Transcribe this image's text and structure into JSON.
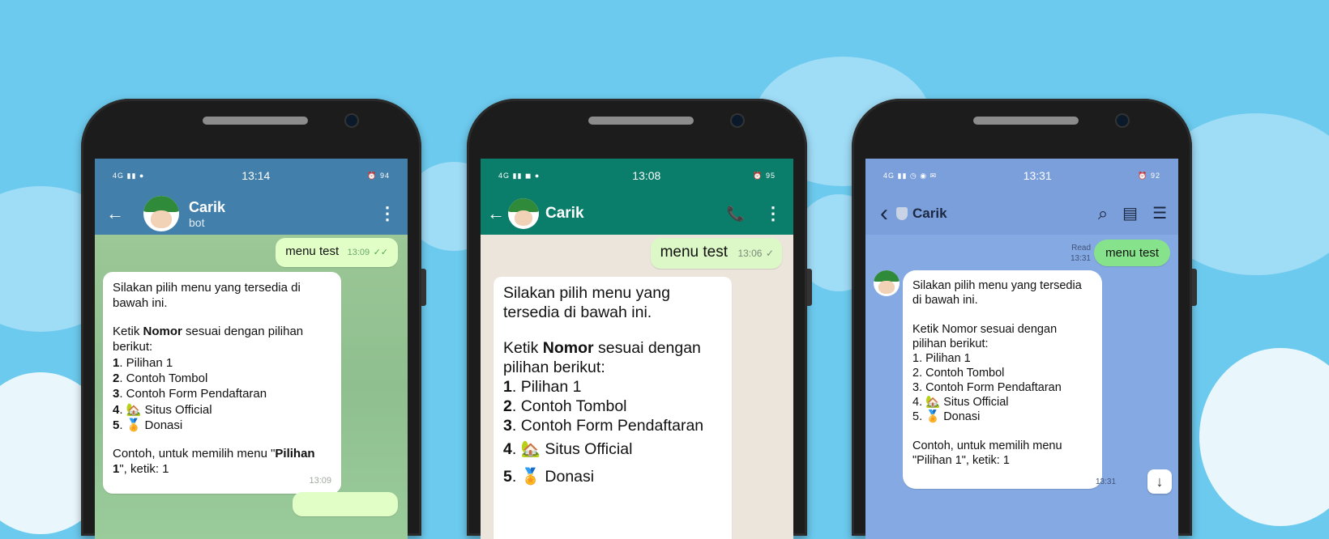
{
  "telegram": {
    "status_time": "13:14",
    "status_left": "4G ▮▮ ●",
    "status_right": "⏰ 94",
    "contact_name": "Carik",
    "contact_sub": "bot",
    "back_glyph": "←",
    "menu_glyph": "⋮",
    "sent_text": "menu test",
    "sent_time": "13:09",
    "sent_ticks": "✓✓",
    "recv_line1": "Silakan pilih menu yang tersedia di",
    "recv_line2": "bawah ini.",
    "recv_ketik_pre": "Ketik ",
    "recv_ketik_bold": "Nomor",
    "recv_ketik_post": " sesuai dengan pilihan",
    "recv_berikut": "berikut:",
    "items": [
      {
        "num": "1",
        "text": ". Pilihan 1"
      },
      {
        "num": "2",
        "text": ". Contoh Tombol"
      },
      {
        "num": "3",
        "text": ". Contoh Form Pendaftaran"
      },
      {
        "num": "4",
        "text": ". 🏡 Situs Official"
      },
      {
        "num": "5",
        "text": ". 🏅 Donasi"
      }
    ],
    "contoh_pre": "Contoh, untuk memilih menu \"",
    "contoh_bold": "Pilihan",
    "contoh_bold2": "1",
    "contoh_post": "\", ketik: 1",
    "recv_time": "13:09"
  },
  "whatsapp": {
    "status_time": "13:08",
    "status_left": "4G ▮▮ ◼ ●",
    "status_right": "⏰ 95",
    "contact_name": "Carik",
    "back_glyph": "←",
    "call_glyph": "📞",
    "menu_glyph": "⋮",
    "sent_text": "menu test",
    "sent_time": "13:06",
    "sent_tick": "✓",
    "recv_line1": "Silakan pilih menu yang",
    "recv_line2": "tersedia di bawah ini.",
    "recv_ketik_pre": "Ketik ",
    "recv_ketik_bold": "Nomor",
    "recv_ketik_post": " sesuai dengan",
    "recv_berikut": "pilihan berikut:",
    "items": [
      {
        "num": "1",
        "text": ". Pilihan 1"
      },
      {
        "num": "2",
        "text": ". Contoh Tombol"
      },
      {
        "num": "3",
        "text": ". Contoh Form Pendaftaran"
      },
      {
        "num": "4",
        "text": ". 🏡 Situs Official"
      },
      {
        "num": "5",
        "text": ". 🏅 Donasi"
      }
    ]
  },
  "line": {
    "status_time": "13:31",
    "status_left": "4G ▮▮ ◷ ◉ ✉",
    "status_right": "⏰ 92",
    "contact_name": "Carik",
    "back_glyph": "‹",
    "search_glyph": "⌕",
    "note_glyph": "▤",
    "menu_glyph": "☰",
    "read_label": "Read",
    "read_time": "13:31",
    "sent_text": "menu test",
    "recv_lines": [
      "Silakan pilih menu yang tersedia",
      "di bawah ini.",
      "",
      "Ketik Nomor sesuai dengan",
      "pilihan berikut:",
      "1. Pilihan 1",
      "2. Contoh Tombol",
      "3. Contoh Form Pendaftaran",
      "4. 🏡 Situs Official",
      "5. 🏅 Donasi",
      "",
      "Contoh, untuk memilih menu",
      "\"Pilihan 1\", ketik: 1"
    ],
    "recv_time": "13:31",
    "scroll_glyph": "↓"
  }
}
